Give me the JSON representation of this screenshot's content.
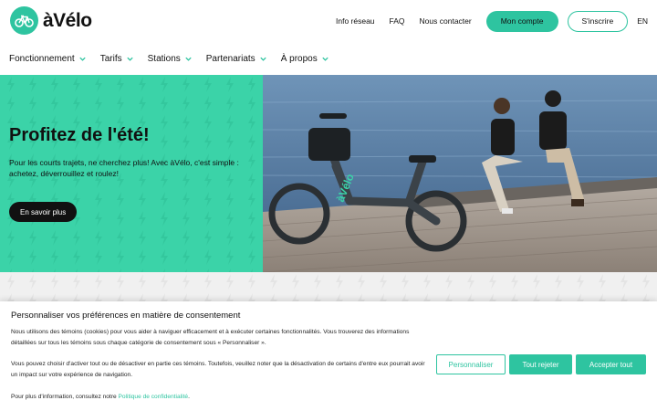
{
  "brand": {
    "name": "àVélo",
    "accent_color": "#2ec4a0",
    "logo_icon": "bicycle-icon"
  },
  "top_links": {
    "network_info": "Info réseau",
    "faq": "FAQ",
    "contact": "Nous contacter",
    "my_account": "Mon compte",
    "sign_up": "S'inscrire",
    "language": "EN"
  },
  "nav": {
    "items": [
      "Fonctionnement",
      "Tarifs",
      "Stations",
      "Partenariats",
      "À propos"
    ]
  },
  "hero": {
    "title": "Profitez de l'été!",
    "text": "Pour les courts trajets, ne cherchez plus! Avec àVélo, c'est simple : achetez, déverrouillez et roulez!",
    "cta": "En savoir plus",
    "image_alt": "two-people-with-bike-by-water",
    "bike_brand": "àVélo"
  },
  "consent": {
    "title": "Personnaliser vos préférences en matière de consentement",
    "p1": "Nous utilisons des témoins (cookies) pour vous aider à naviguer efficacement et à exécuter certaines fonctionnalités. Vous trouverez des informations détaillées sur tous les témoins sous chaque catégorie de consentement sous « Personnaliser ».",
    "p2": "Vous pouvez choisir d'activer tout ou de désactiver en partie ces témoins. Toutefois, veuillez noter que la désactivation de certains d'entre eux pourrait avoir un impact sur votre expérience de navigation.",
    "p3_prefix": "Pour plus d'information, consultez notre ",
    "p3_link": "Politique de confidentialité",
    "p3_suffix": ".",
    "btn_customize": "Personnaliser",
    "btn_reject": "Tout rejeter",
    "btn_accept": "Accepter tout"
  }
}
